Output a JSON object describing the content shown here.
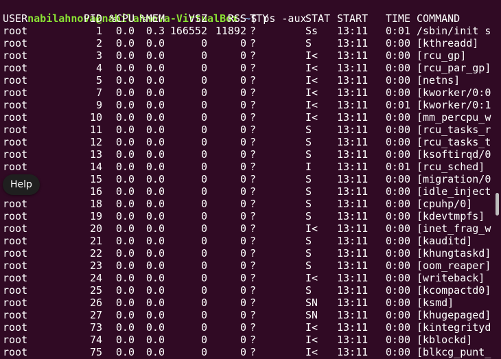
{
  "prompt": {
    "user_host": "nabilahnova@nabilahnova-VirtualBox",
    "separator": ":",
    "path": "~",
    "symbol": "$",
    "command": "ps -aux"
  },
  "columns": {
    "user": "USER",
    "pid": "PID",
    "cpu": "%CPU",
    "mem": "%MEM",
    "vsz": "VSZ",
    "rss": "RSS",
    "tty": "TTY",
    "stat": "STAT",
    "start": "START",
    "time": "TIME",
    "command": "COMMAND"
  },
  "rows": [
    {
      "user": "root",
      "pid": "1",
      "cpu": "0.0",
      "mem": "0.3",
      "vsz": "166552",
      "rss": "11892",
      "tty": "?",
      "stat": "Ss",
      "start": "13:11",
      "time": "0:01",
      "command": "/sbin/init s"
    },
    {
      "user": "root",
      "pid": "2",
      "cpu": "0.0",
      "mem": "0.0",
      "vsz": "0",
      "rss": "0",
      "tty": "?",
      "stat": "S",
      "start": "13:11",
      "time": "0:00",
      "command": "[kthreadd]"
    },
    {
      "user": "root",
      "pid": "3",
      "cpu": "0.0",
      "mem": "0.0",
      "vsz": "0",
      "rss": "0",
      "tty": "?",
      "stat": "I<",
      "start": "13:11",
      "time": "0:00",
      "command": "[rcu_gp]"
    },
    {
      "user": "root",
      "pid": "4",
      "cpu": "0.0",
      "mem": "0.0",
      "vsz": "0",
      "rss": "0",
      "tty": "?",
      "stat": "I<",
      "start": "13:11",
      "time": "0:00",
      "command": "[rcu_par_gp]"
    },
    {
      "user": "root",
      "pid": "5",
      "cpu": "0.0",
      "mem": "0.0",
      "vsz": "0",
      "rss": "0",
      "tty": "?",
      "stat": "I<",
      "start": "13:11",
      "time": "0:00",
      "command": "[netns]"
    },
    {
      "user": "root",
      "pid": "7",
      "cpu": "0.0",
      "mem": "0.0",
      "vsz": "0",
      "rss": "0",
      "tty": "?",
      "stat": "I<",
      "start": "13:11",
      "time": "0:00",
      "command": "[kworker/0:0"
    },
    {
      "user": "root",
      "pid": "9",
      "cpu": "0.0",
      "mem": "0.0",
      "vsz": "0",
      "rss": "0",
      "tty": "?",
      "stat": "I<",
      "start": "13:11",
      "time": "0:01",
      "command": "[kworker/0:1"
    },
    {
      "user": "root",
      "pid": "10",
      "cpu": "0.0",
      "mem": "0.0",
      "vsz": "0",
      "rss": "0",
      "tty": "?",
      "stat": "I<",
      "start": "13:11",
      "time": "0:00",
      "command": "[mm_percpu_w"
    },
    {
      "user": "root",
      "pid": "11",
      "cpu": "0.0",
      "mem": "0.0",
      "vsz": "0",
      "rss": "0",
      "tty": "?",
      "stat": "S",
      "start": "13:11",
      "time": "0:00",
      "command": "[rcu_tasks_r"
    },
    {
      "user": "root",
      "pid": "12",
      "cpu": "0.0",
      "mem": "0.0",
      "vsz": "0",
      "rss": "0",
      "tty": "?",
      "stat": "S",
      "start": "13:11",
      "time": "0:00",
      "command": "[rcu_tasks_t"
    },
    {
      "user": "root",
      "pid": "13",
      "cpu": "0.0",
      "mem": "0.0",
      "vsz": "0",
      "rss": "0",
      "tty": "?",
      "stat": "S",
      "start": "13:11",
      "time": "0:00",
      "command": "[ksoftirqd/0"
    },
    {
      "user": "root",
      "pid": "14",
      "cpu": "0.0",
      "mem": "0.0",
      "vsz": "0",
      "rss": "0",
      "tty": "?",
      "stat": "I",
      "start": "13:11",
      "time": "0:01",
      "command": "[rcu_sched]"
    },
    {
      "user": "",
      "pid": "15",
      "cpu": "0.0",
      "mem": "0.0",
      "vsz": "0",
      "rss": "0",
      "tty": "?",
      "stat": "S",
      "start": "13:11",
      "time": "0:00",
      "command": "[migration/0"
    },
    {
      "user": "",
      "pid": "16",
      "cpu": "0.0",
      "mem": "0.0",
      "vsz": "0",
      "rss": "0",
      "tty": "?",
      "stat": "S",
      "start": "13:11",
      "time": "0:00",
      "command": "[idle_inject"
    },
    {
      "user": "root",
      "pid": "18",
      "cpu": "0.0",
      "mem": "0.0",
      "vsz": "0",
      "rss": "0",
      "tty": "?",
      "stat": "S",
      "start": "13:11",
      "time": "0:00",
      "command": "[cpuhp/0]"
    },
    {
      "user": "root",
      "pid": "19",
      "cpu": "0.0",
      "mem": "0.0",
      "vsz": "0",
      "rss": "0",
      "tty": "?",
      "stat": "S",
      "start": "13:11",
      "time": "0:00",
      "command": "[kdevtmpfs]"
    },
    {
      "user": "root",
      "pid": "20",
      "cpu": "0.0",
      "mem": "0.0",
      "vsz": "0",
      "rss": "0",
      "tty": "?",
      "stat": "I<",
      "start": "13:11",
      "time": "0:00",
      "command": "[inet_frag_w"
    },
    {
      "user": "root",
      "pid": "21",
      "cpu": "0.0",
      "mem": "0.0",
      "vsz": "0",
      "rss": "0",
      "tty": "?",
      "stat": "S",
      "start": "13:11",
      "time": "0:00",
      "command": "[kauditd]"
    },
    {
      "user": "root",
      "pid": "22",
      "cpu": "0.0",
      "mem": "0.0",
      "vsz": "0",
      "rss": "0",
      "tty": "?",
      "stat": "S",
      "start": "13:11",
      "time": "0:00",
      "command": "[khungtaskd]"
    },
    {
      "user": "root",
      "pid": "23",
      "cpu": "0.0",
      "mem": "0.0",
      "vsz": "0",
      "rss": "0",
      "tty": "?",
      "stat": "S",
      "start": "13:11",
      "time": "0:00",
      "command": "[oom_reaper]"
    },
    {
      "user": "root",
      "pid": "24",
      "cpu": "0.0",
      "mem": "0.0",
      "vsz": "0",
      "rss": "0",
      "tty": "?",
      "stat": "I<",
      "start": "13:11",
      "time": "0:00",
      "command": "[writeback]"
    },
    {
      "user": "root",
      "pid": "25",
      "cpu": "0.0",
      "mem": "0.0",
      "vsz": "0",
      "rss": "0",
      "tty": "?",
      "stat": "S",
      "start": "13:11",
      "time": "0:00",
      "command": "[kcompactd0]"
    },
    {
      "user": "root",
      "pid": "26",
      "cpu": "0.0",
      "mem": "0.0",
      "vsz": "0",
      "rss": "0",
      "tty": "?",
      "stat": "SN",
      "start": "13:11",
      "time": "0:00",
      "command": "[ksmd]"
    },
    {
      "user": "root",
      "pid": "27",
      "cpu": "0.0",
      "mem": "0.0",
      "vsz": "0",
      "rss": "0",
      "tty": "?",
      "stat": "SN",
      "start": "13:11",
      "time": "0:00",
      "command": "[khugepaged]"
    },
    {
      "user": "root",
      "pid": "73",
      "cpu": "0.0",
      "mem": "0.0",
      "vsz": "0",
      "rss": "0",
      "tty": "?",
      "stat": "I<",
      "start": "13:11",
      "time": "0:00",
      "command": "[kintegrityd"
    },
    {
      "user": "root",
      "pid": "74",
      "cpu": "0.0",
      "mem": "0.0",
      "vsz": "0",
      "rss": "0",
      "tty": "?",
      "stat": "I<",
      "start": "13:11",
      "time": "0:00",
      "command": "[kblockd]"
    },
    {
      "user": "root",
      "pid": "75",
      "cpu": "0.0",
      "mem": "0.0",
      "vsz": "0",
      "rss": "0",
      "tty": "?",
      "stat": "I<",
      "start": "13:11",
      "time": "0:00",
      "command": "[blkcg_punt_"
    }
  ],
  "help": {
    "label": "Help"
  },
  "theme": {
    "background": "#300a24",
    "text": "#ffffff",
    "prompt_user": "#8ae234",
    "prompt_path": "#729fcf",
    "help_background": "#1f1f1f",
    "scrollbar": "#bdbdbd"
  }
}
